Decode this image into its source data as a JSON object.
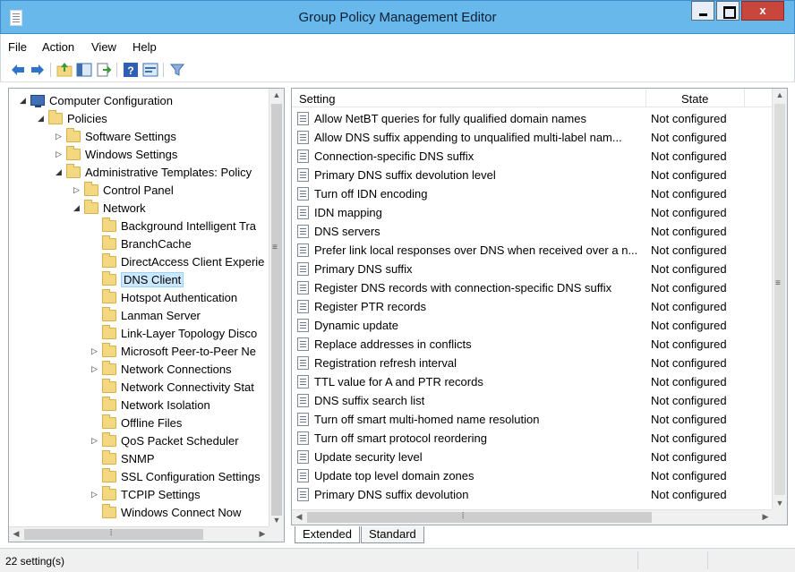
{
  "window": {
    "title": "Group Policy Management Editor",
    "close_label": "x"
  },
  "menu": [
    "File",
    "Action",
    "View",
    "Help"
  ],
  "toolbar_icons": [
    "back-arrow-icon",
    "forward-arrow-icon",
    "up-folder-icon",
    "show-hide-tree-icon",
    "export-list-icon",
    "help-icon",
    "properties-icon",
    "filter-icon"
  ],
  "tree": {
    "nodes": [
      {
        "label": "Computer Configuration",
        "expander": "◢"
      },
      {
        "label": "Policies",
        "expander": "◢"
      },
      {
        "label": "Software Settings",
        "expander": "▷"
      },
      {
        "label": "Windows Settings",
        "expander": "▷"
      },
      {
        "label": "Administrative Templates: Policy",
        "expander": "◢"
      },
      {
        "label": "Control Panel",
        "expander": "▷"
      },
      {
        "label": "Network",
        "expander": "◢"
      },
      {
        "label": "Background Intelligent Tra",
        "expander": ""
      },
      {
        "label": "BranchCache",
        "expander": ""
      },
      {
        "label": "DirectAccess Client Experie",
        "expander": ""
      },
      {
        "label": "DNS Client",
        "expander": ""
      },
      {
        "label": "Hotspot Authentication",
        "expander": ""
      },
      {
        "label": "Lanman Server",
        "expander": ""
      },
      {
        "label": "Link-Layer Topology Disco",
        "expander": ""
      },
      {
        "label": "Microsoft Peer-to-Peer Ne",
        "expander": "▷"
      },
      {
        "label": "Network Connections",
        "expander": "▷"
      },
      {
        "label": "Network Connectivity Stat",
        "expander": ""
      },
      {
        "label": "Network Isolation",
        "expander": ""
      },
      {
        "label": "Offline Files",
        "expander": ""
      },
      {
        "label": "QoS Packet Scheduler",
        "expander": "▷"
      },
      {
        "label": "SNMP",
        "expander": ""
      },
      {
        "label": "SSL Configuration Settings",
        "expander": ""
      },
      {
        "label": "TCPIP Settings",
        "expander": "▷"
      },
      {
        "label": "Windows Connect Now",
        "expander": ""
      }
    ],
    "selected": "DNS Client"
  },
  "list": {
    "columns": {
      "setting": "Setting",
      "state": "State"
    },
    "rows": [
      {
        "name": "Allow NetBT queries for fully qualified domain names",
        "state": "Not configured"
      },
      {
        "name": "Allow DNS suffix appending to unqualified multi-label nam...",
        "state": "Not configured"
      },
      {
        "name": "Connection-specific DNS suffix",
        "state": "Not configured"
      },
      {
        "name": "Primary DNS suffix devolution level",
        "state": "Not configured"
      },
      {
        "name": "Turn off IDN encoding",
        "state": "Not configured"
      },
      {
        "name": "IDN mapping",
        "state": "Not configured"
      },
      {
        "name": "DNS servers",
        "state": "Not configured"
      },
      {
        "name": "Prefer link local responses over DNS when received over a n...",
        "state": "Not configured"
      },
      {
        "name": "Primary DNS suffix",
        "state": "Not configured"
      },
      {
        "name": "Register DNS records with connection-specific DNS suffix",
        "state": "Not configured"
      },
      {
        "name": "Register PTR records",
        "state": "Not configured"
      },
      {
        "name": "Dynamic update",
        "state": "Not configured"
      },
      {
        "name": "Replace addresses in conflicts",
        "state": "Not configured"
      },
      {
        "name": "Registration refresh interval",
        "state": "Not configured"
      },
      {
        "name": "TTL value for A and PTR records",
        "state": "Not configured"
      },
      {
        "name": "DNS suffix search list",
        "state": "Not configured"
      },
      {
        "name": "Turn off smart multi-homed name resolution",
        "state": "Not configured"
      },
      {
        "name": "Turn off smart protocol reordering",
        "state": "Not configured"
      },
      {
        "name": "Update security level",
        "state": "Not configured"
      },
      {
        "name": "Update top level domain zones",
        "state": "Not configured"
      },
      {
        "name": "Primary DNS suffix devolution",
        "state": "Not configured"
      }
    ]
  },
  "tabs": [
    "Extended",
    "Standard"
  ],
  "status": {
    "text": "22 setting(s)"
  },
  "colors": {
    "titlebar": "#69b8ec",
    "close_button": "#c9463d",
    "selection": "#cce8ff",
    "folder": "#f4d781"
  }
}
